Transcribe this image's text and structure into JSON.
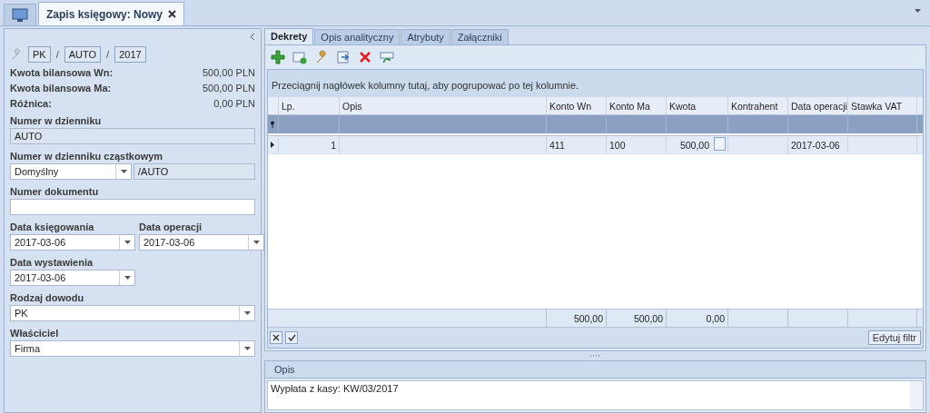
{
  "window_tabs": [
    {
      "kind": "home",
      "selected": false
    },
    {
      "kind": "document",
      "label": "Zapis księgowy: Nowy",
      "selected": true,
      "closable": true
    }
  ],
  "left_panel": {
    "number_parts": [
      "PK",
      "AUTO",
      "2017"
    ],
    "separators": [
      "/",
      "/"
    ],
    "balances": [
      {
        "label": "Kwota bilansowa Wn:",
        "value": "500,00 PLN"
      },
      {
        "label": "Kwota bilansowa Ma:",
        "value": "500,00 PLN"
      },
      {
        "label": "Różnica:",
        "value": "0,00 PLN"
      }
    ],
    "rows": [
      [
        {
          "kind": "readonly",
          "label": "Numer w dzienniku",
          "value": "AUTO"
        }
      ],
      [
        {
          "kind": "combo_suffix",
          "label": "Numer w dzienniku cząstkowym",
          "value": "Domyślny",
          "suffix": "/AUTO"
        }
      ],
      [
        {
          "kind": "text",
          "label": "Numer dokumentu"
        }
      ],
      [
        {
          "kind": "date",
          "label": "Data księgowania",
          "value": "2017-03-06"
        },
        {
          "kind": "date",
          "label": "Data operacji",
          "value": "2017-03-06"
        }
      ],
      [
        {
          "kind": "date",
          "label": "Data wystawienia",
          "value": "2017-03-06"
        }
      ],
      [
        {
          "kind": "combo",
          "label": "Rodzaj dowodu",
          "value": "PK"
        }
      ],
      [
        {
          "kind": "combo",
          "label": "Właściciel",
          "value": "Firma"
        }
      ]
    ]
  },
  "tabs": [
    {
      "label": "Dekrety",
      "selected": true
    },
    {
      "label": "Opis analityczny",
      "selected": false
    },
    {
      "label": "Atrybuty",
      "selected": false
    },
    {
      "label": "Załączniki",
      "selected": false
    }
  ],
  "grid": {
    "group_hint": "Przeciągnij nagłówek kolumny tutaj, aby pogrupować po tej kolumnie.",
    "columns": [
      "Lp.",
      "Opis",
      "Konto Wn",
      "Konto Ma",
      "Kwota",
      "Kontrahent",
      "Data operacji",
      "Stawka VAT"
    ],
    "rows": [
      {
        "current": true,
        "cells": {
          "lp": "1",
          "konto_wn": "411",
          "konto_ma": "100",
          "kwota": "500,00",
          "data_operacji": "2017-03-06"
        }
      }
    ],
    "summary": {
      "konto_wn": "500,00",
      "konto_ma": "500,00",
      "kwota": "0,00"
    },
    "filter_button": "Edytuj filtr"
  },
  "description": {
    "title": "Opis",
    "value": "Wypłata z kasy: KW/03/2017"
  }
}
